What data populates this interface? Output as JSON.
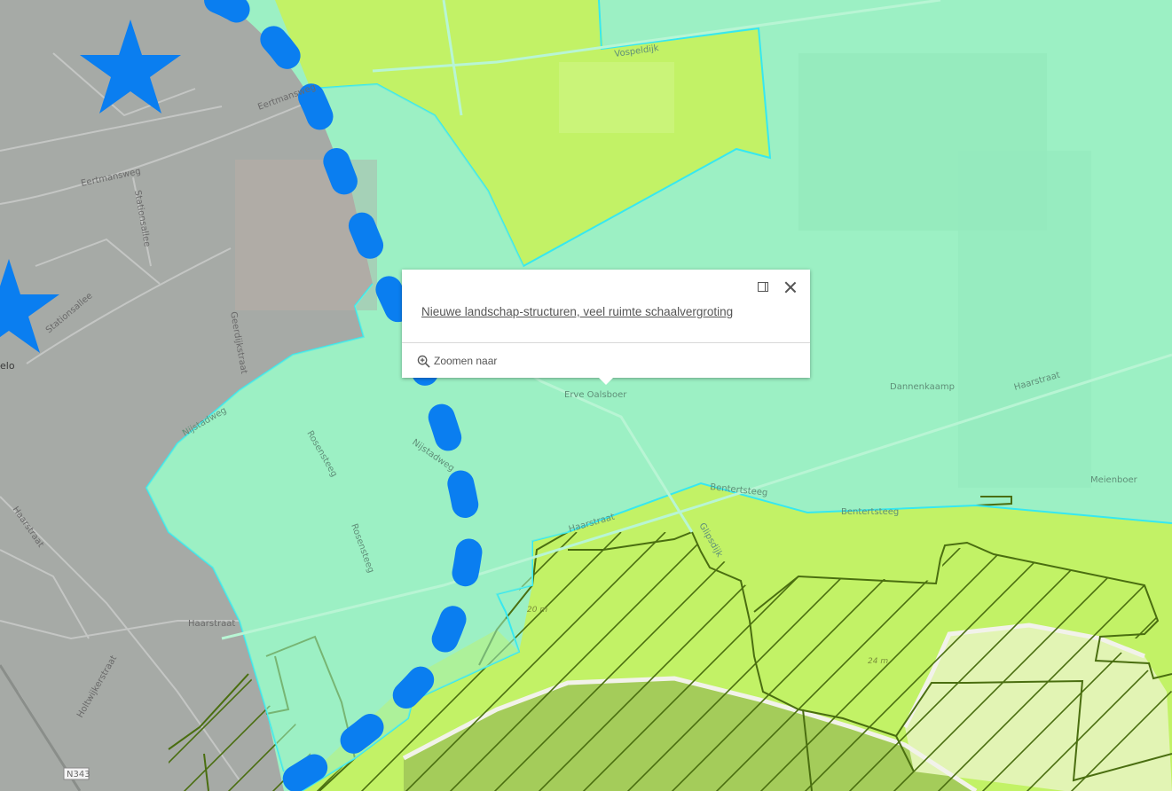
{
  "popup": {
    "title": "Nieuwe landschap-structuren, veel ruimte schaalvergroting",
    "zoom_label": "Zoomen naar",
    "zoom_icon": "zoom-in-icon",
    "dock_icon": "dock-icon",
    "close_icon": "close-icon"
  },
  "map_labels": {
    "vospeldijk": "Vospeldijk",
    "eertmansweg_1": "Eertmansweg",
    "eertmansweg_2": "Eertmansweg",
    "stationsallee_1": "Stationsallee",
    "stationsallee_2": "Stationsallee",
    "geerdijkstraat": "Geerdijkstraat",
    "place_partial": "elo",
    "nijstadweg_1": "Nijstadweg",
    "nijstadweg_2": "Nijstadweg",
    "rosensteeg_1": "Rosensteeg",
    "rosensteeg_2": "Rosensteeg",
    "haarstraat_1": "Haarstraat",
    "haarstraat_2": "Haarstraat",
    "haarstraat_3": "Haarstraat",
    "haarstraat_4": "Haarstraat",
    "holtwijkerstraat": "Holtwijkerstraat",
    "road_shield": "N343",
    "erve_oalsboer": "Erve Oalsboer",
    "dannenkaamp": "Dannenkaamp",
    "meienboer": "Meienboer",
    "bentertsteeg_1": "Bentertsteeg",
    "bentertsteeg_2": "Bentertsteeg",
    "glipsdijk": "Glipsdijk",
    "spot_20m": "20 m",
    "spot_24m": "24 m"
  },
  "colors": {
    "urban_gray": "#a6aaa6",
    "zone_mint": "#9cf0c4",
    "zone_lime": "#c2f266",
    "hatch_dark": "#4a6e10",
    "boundary_cyan": "#36e8f0",
    "dashed_blue": "#0a7ef0",
    "star_blue": "#0a7ef0"
  }
}
